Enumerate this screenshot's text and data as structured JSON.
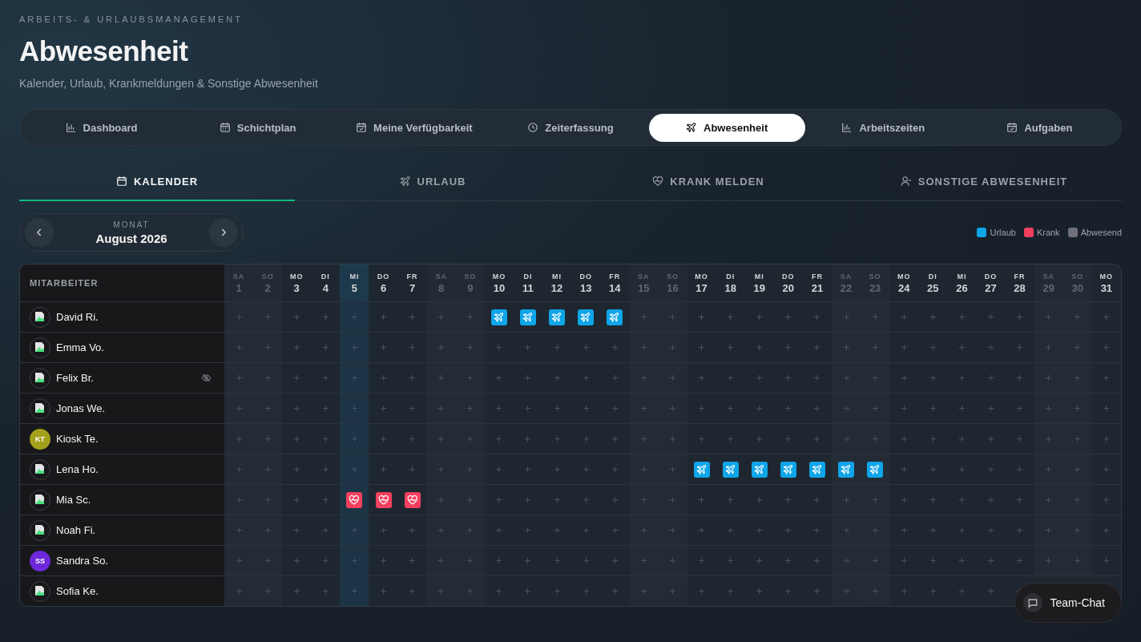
{
  "header": {
    "eyebrow": "ARBEITS- & URLAUBSMANAGEMENT",
    "title": "Abwesenheit",
    "subtitle": "Kalender, Urlaub, Krankmeldungen & Sonstige Abwesenheit"
  },
  "nav": [
    {
      "label": "Dashboard",
      "selected": false
    },
    {
      "label": "Schichtplan",
      "selected": false
    },
    {
      "label": "Meine Verfügbarkeit",
      "selected": false
    },
    {
      "label": "Zeiterfassung",
      "selected": false
    },
    {
      "label": "Abwesenheit",
      "selected": true
    },
    {
      "label": "Arbeitszeiten",
      "selected": false
    },
    {
      "label": "Aufgaben",
      "selected": false
    }
  ],
  "subtabs": [
    {
      "label": "KALENDER",
      "selected": true
    },
    {
      "label": "URLAUB",
      "selected": false
    },
    {
      "label": "KRANK MELDEN",
      "selected": false
    },
    {
      "label": "SONSTIGE ABWESENHEIT",
      "selected": false
    }
  ],
  "month": {
    "caption": "MONAT",
    "value": "August 2026"
  },
  "legend": [
    {
      "label": "Urlaub",
      "color": "#0ea5e9"
    },
    {
      "label": "Krank",
      "color": "#f43f5e"
    },
    {
      "label": "Abwesend",
      "color": "#71717a"
    }
  ],
  "table": {
    "employee_heading": "MITARBEITER",
    "days": [
      {
        "weekday": "SA",
        "day": "1",
        "weekend": true,
        "today": false
      },
      {
        "weekday": "SO",
        "day": "2",
        "weekend": true,
        "today": false
      },
      {
        "weekday": "MO",
        "day": "3",
        "weekend": false,
        "today": false
      },
      {
        "weekday": "DI",
        "day": "4",
        "weekend": false,
        "today": false
      },
      {
        "weekday": "MI",
        "day": "5",
        "weekend": false,
        "today": true
      },
      {
        "weekday": "DO",
        "day": "6",
        "weekend": false,
        "today": false
      },
      {
        "weekday": "FR",
        "day": "7",
        "weekend": false,
        "today": false
      },
      {
        "weekday": "SA",
        "day": "8",
        "weekend": true,
        "today": false
      },
      {
        "weekday": "SO",
        "day": "9",
        "weekend": true,
        "today": false
      },
      {
        "weekday": "MO",
        "day": "10",
        "weekend": false,
        "today": false
      },
      {
        "weekday": "DI",
        "day": "11",
        "weekend": false,
        "today": false
      },
      {
        "weekday": "MI",
        "day": "12",
        "weekend": false,
        "today": false
      },
      {
        "weekday": "DO",
        "day": "13",
        "weekend": false,
        "today": false
      },
      {
        "weekday": "FR",
        "day": "14",
        "weekend": false,
        "today": false
      },
      {
        "weekday": "SA",
        "day": "15",
        "weekend": true,
        "today": false
      },
      {
        "weekday": "SO",
        "day": "16",
        "weekend": true,
        "today": false
      },
      {
        "weekday": "MO",
        "day": "17",
        "weekend": false,
        "today": false
      },
      {
        "weekday": "DI",
        "day": "18",
        "weekend": false,
        "today": false
      },
      {
        "weekday": "MI",
        "day": "19",
        "weekend": false,
        "today": false
      },
      {
        "weekday": "DO",
        "day": "20",
        "weekend": false,
        "today": false
      },
      {
        "weekday": "FR",
        "day": "21",
        "weekend": false,
        "today": false
      },
      {
        "weekday": "SA",
        "day": "22",
        "weekend": true,
        "today": false
      },
      {
        "weekday": "SO",
        "day": "23",
        "weekend": true,
        "today": false
      },
      {
        "weekday": "MO",
        "day": "24",
        "weekend": false,
        "today": false
      },
      {
        "weekday": "DI",
        "day": "25",
        "weekend": false,
        "today": false
      },
      {
        "weekday": "MI",
        "day": "26",
        "weekend": false,
        "today": false
      },
      {
        "weekday": "DO",
        "day": "27",
        "weekend": false,
        "today": false
      },
      {
        "weekday": "FR",
        "day": "28",
        "weekend": false,
        "today": false
      },
      {
        "weekday": "SA",
        "day": "29",
        "weekend": true,
        "today": false
      },
      {
        "weekday": "SO",
        "day": "30",
        "weekend": true,
        "today": false
      },
      {
        "weekday": "MO",
        "day": "31",
        "weekend": false,
        "today": false
      }
    ],
    "employees": [
      {
        "name": "David Ri.",
        "avatar": {
          "kind": "image"
        },
        "hidden": false,
        "cells": [
          {
            "kind": "none"
          },
          {
            "kind": "none"
          },
          {
            "kind": "none"
          },
          {
            "kind": "none"
          },
          {
            "kind": "none"
          },
          {
            "kind": "none"
          },
          {
            "kind": "none"
          },
          {
            "kind": "none"
          },
          {
            "kind": "none"
          },
          {
            "kind": "vacation"
          },
          {
            "kind": "vacation"
          },
          {
            "kind": "vacation"
          },
          {
            "kind": "vacation"
          },
          {
            "kind": "vacation"
          },
          {
            "kind": "none"
          },
          {
            "kind": "none"
          },
          {
            "kind": "none"
          },
          {
            "kind": "none"
          },
          {
            "kind": "none"
          },
          {
            "kind": "none"
          },
          {
            "kind": "none"
          },
          {
            "kind": "none"
          },
          {
            "kind": "none"
          },
          {
            "kind": "none"
          },
          {
            "kind": "none"
          },
          {
            "kind": "none"
          },
          {
            "kind": "none"
          },
          {
            "kind": "none"
          },
          {
            "kind": "none"
          },
          {
            "kind": "none"
          },
          {
            "kind": "none"
          }
        ]
      },
      {
        "name": "Emma Vo.",
        "avatar": {
          "kind": "image"
        },
        "hidden": false
      },
      {
        "name": "Felix Br.",
        "avatar": {
          "kind": "image"
        },
        "hidden": true
      },
      {
        "name": "Jonas We.",
        "avatar": {
          "kind": "image"
        },
        "hidden": false
      },
      {
        "name": "Kiosk Te.",
        "avatar": {
          "kind": "initials",
          "initials": "KT",
          "color": "#a3a01c"
        },
        "hidden": false
      },
      {
        "name": "Lena Ho.",
        "avatar": {
          "kind": "image"
        },
        "hidden": false,
        "cells": [
          {
            "kind": "none"
          },
          {
            "kind": "none"
          },
          {
            "kind": "none"
          },
          {
            "kind": "none"
          },
          {
            "kind": "none"
          },
          {
            "kind": "none"
          },
          {
            "kind": "none"
          },
          {
            "kind": "none"
          },
          {
            "kind": "none"
          },
          {
            "kind": "none"
          },
          {
            "kind": "none"
          },
          {
            "kind": "none"
          },
          {
            "kind": "none"
          },
          {
            "kind": "none"
          },
          {
            "kind": "none"
          },
          {
            "kind": "none"
          },
          {
            "kind": "vacation"
          },
          {
            "kind": "vacation"
          },
          {
            "kind": "vacation"
          },
          {
            "kind": "vacation"
          },
          {
            "kind": "vacation"
          },
          {
            "kind": "vacation"
          },
          {
            "kind": "vacation"
          },
          {
            "kind": "none"
          },
          {
            "kind": "none"
          },
          {
            "kind": "none"
          },
          {
            "kind": "none"
          },
          {
            "kind": "none"
          },
          {
            "kind": "none"
          },
          {
            "kind": "none"
          },
          {
            "kind": "none"
          }
        ]
      },
      {
        "name": "Mia Sc.",
        "avatar": {
          "kind": "image"
        },
        "hidden": false,
        "cells": [
          {
            "kind": "none"
          },
          {
            "kind": "none"
          },
          {
            "kind": "none"
          },
          {
            "kind": "none"
          },
          {
            "kind": "sick"
          },
          {
            "kind": "sick"
          },
          {
            "kind": "sick"
          },
          {
            "kind": "none"
          },
          {
            "kind": "none"
          },
          {
            "kind": "none"
          },
          {
            "kind": "none"
          },
          {
            "kind": "none"
          },
          {
            "kind": "none"
          },
          {
            "kind": "none"
          },
          {
            "kind": "none"
          },
          {
            "kind": "none"
          },
          {
            "kind": "none"
          },
          {
            "kind": "none"
          },
          {
            "kind": "none"
          },
          {
            "kind": "none"
          },
          {
            "kind": "none"
          },
          {
            "kind": "none"
          },
          {
            "kind": "none"
          },
          {
            "kind": "none"
          },
          {
            "kind": "none"
          },
          {
            "kind": "none"
          },
          {
            "kind": "none"
          },
          {
            "kind": "none"
          },
          {
            "kind": "none"
          },
          {
            "kind": "none"
          },
          {
            "kind": "none"
          }
        ]
      },
      {
        "name": "Noah Fi.",
        "avatar": {
          "kind": "image"
        },
        "hidden": false
      },
      {
        "name": "Sandra So.",
        "avatar": {
          "kind": "initials",
          "initials": "SS",
          "color": "#6d28d9"
        },
        "hidden": false
      },
      {
        "name": "Sofia Ke.",
        "avatar": {
          "kind": "image"
        },
        "hidden": false
      }
    ]
  },
  "chat_button": {
    "label": "Team-Chat"
  }
}
